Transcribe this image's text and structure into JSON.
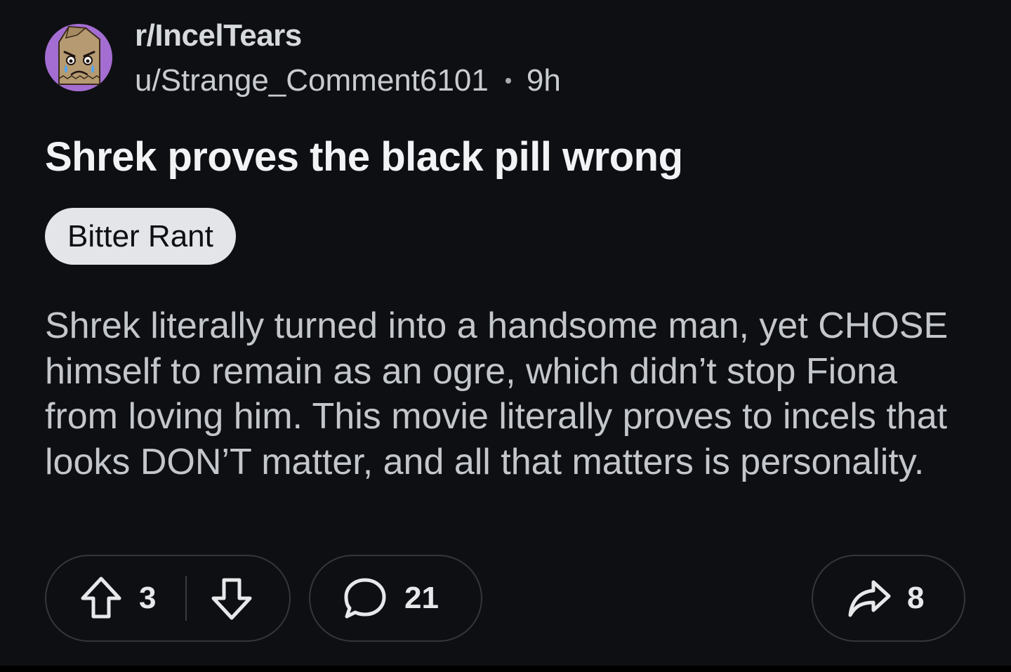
{
  "post": {
    "subreddit": "r/IncelTears",
    "author": "u/Strange_Comment6101",
    "age": "9h",
    "title": "Shrek proves the black pill wrong",
    "flair": "Bitter Rant",
    "body": "Shrek literally turned into a handsome man, yet CHOSE himself to remain as an ogre, which didn’t stop Fiona from loving him. This movie literally proves to incels that looks DON’T matter, and all that matters is personality."
  },
  "actions": {
    "score": "3",
    "comments": "21",
    "shares": "8",
    "upvote_icon": "arrow-up-outline-icon",
    "downvote_icon": "arrow-down-outline-icon",
    "comment_icon": "speech-bubble-icon",
    "share_icon": "share-arrow-icon"
  },
  "colors": {
    "background": "#0e0f13",
    "avatar_bg": "#a46dd2",
    "flair_bg": "#e3e5e8",
    "pill_border": "#34363b"
  }
}
